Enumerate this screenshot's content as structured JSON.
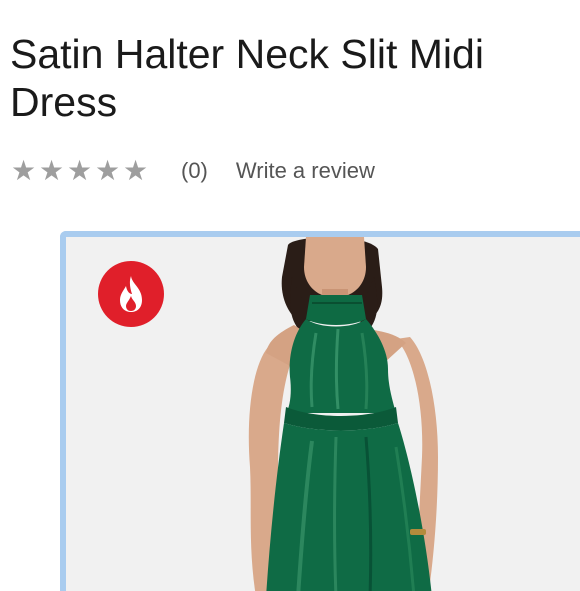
{
  "page": {
    "title": "Satin Halter Neck Slit Midi Dress"
  },
  "rating": {
    "stars_total": 5,
    "stars_filled": 0,
    "star_glyph": "★",
    "count_text": "(0)",
    "write_review_label": "Write a review"
  },
  "product_image": {
    "badge_icon": "fire-icon",
    "dress_color": "#0f6b45",
    "accent_border": "#a9ccef",
    "badge_color": "#e01f2a"
  }
}
